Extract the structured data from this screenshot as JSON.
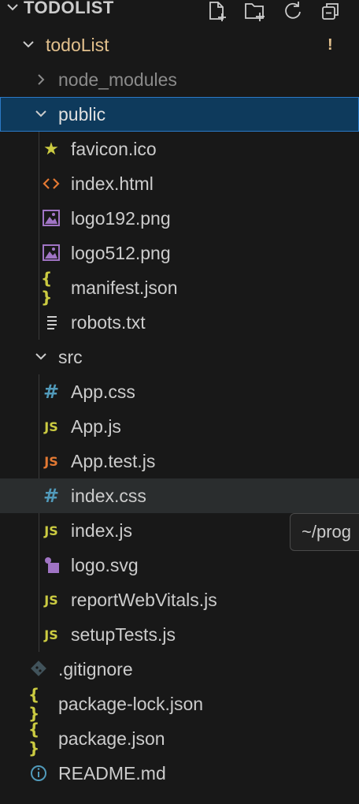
{
  "explorer": {
    "title": "TODOLIST",
    "actions": [
      "new-file-icon",
      "new-folder-icon",
      "refresh-icon",
      "collapse-all-icon"
    ]
  },
  "tree": {
    "project": {
      "label": "todoList",
      "badge": "!"
    },
    "node_modules": {
      "label": "node_modules"
    },
    "public": {
      "label": "public",
      "files": [
        {
          "label": "favicon.ico",
          "icon": "star-icon"
        },
        {
          "label": "index.html",
          "icon": "html-icon"
        },
        {
          "label": "logo192.png",
          "icon": "image-icon"
        },
        {
          "label": "logo512.png",
          "icon": "image-icon"
        },
        {
          "label": "manifest.json",
          "icon": "json-icon"
        },
        {
          "label": "robots.txt",
          "icon": "text-file-icon"
        }
      ]
    },
    "src": {
      "label": "src",
      "files": [
        {
          "label": "App.css",
          "icon": "css-icon"
        },
        {
          "label": "App.js",
          "icon": "js-icon"
        },
        {
          "label": "App.test.js",
          "icon": "js-test-icon"
        },
        {
          "label": "index.css",
          "icon": "css-icon"
        },
        {
          "label": "index.js",
          "icon": "js-icon"
        },
        {
          "label": "logo.svg",
          "icon": "svg-icon"
        },
        {
          "label": "reportWebVitals.js",
          "icon": "js-icon"
        },
        {
          "label": "setupTests.js",
          "icon": "js-icon"
        }
      ]
    },
    "root_files": [
      {
        "label": ".gitignore",
        "icon": "git-icon"
      },
      {
        "label": "package-lock.json",
        "icon": "json-icon"
      },
      {
        "label": "package.json",
        "icon": "json-icon"
      },
      {
        "label": "README.md",
        "icon": "info-icon"
      }
    ]
  },
  "tooltip": {
    "text": "~/prog"
  },
  "colors": {
    "background": "#181818",
    "selected": "#0e3a5c",
    "selected_border": "#2b79c6",
    "hover": "#2a2d2e",
    "project_label": "#e2c08d",
    "folder_muted": "#8b8b8b",
    "js": "#cbcb41",
    "js_test": "#e37933",
    "css": "#519aba",
    "html": "#e37933",
    "image": "#a074c4",
    "star": "#cbcb41"
  }
}
